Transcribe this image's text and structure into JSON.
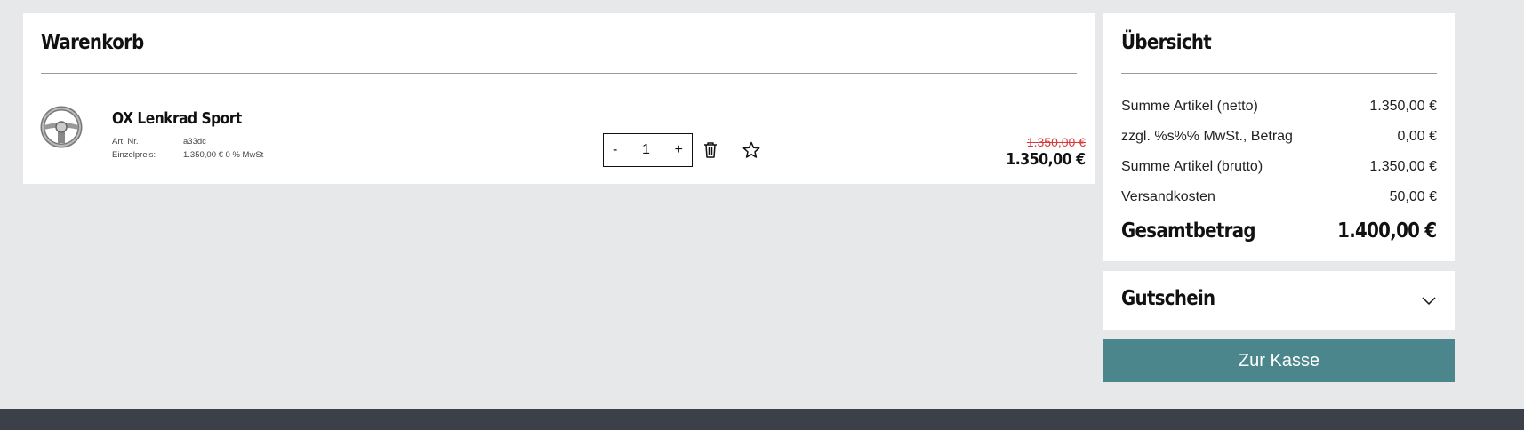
{
  "cart": {
    "title": "Warenkorb",
    "item": {
      "image_alt": "steering-wheel-product-image",
      "name": "OX Lenkrad Sport",
      "art_nr_label": "Art. Nr.",
      "art_nr": "a33dc",
      "unit_price_label": "Einzelpreis:",
      "unit_price": "1.350,00 € 0 % MwSt",
      "quantity": "1",
      "minus_label": "-",
      "plus_label": "+",
      "old_price": "1.350,00 €",
      "price": "1.350,00 €"
    }
  },
  "summary": {
    "title": "Übersicht",
    "rows": [
      {
        "label": "Summe Artikel (netto)",
        "value": "1.350,00 €"
      },
      {
        "label": "zzgl. %s%% MwSt., Betrag",
        "value": "0,00 €"
      },
      {
        "label": "Summe Artikel (brutto)",
        "value": "1.350,00 €"
      },
      {
        "label": "Versandkosten",
        "value": "50,00 €"
      }
    ],
    "total_label": "Gesamtbetrag",
    "total_value": "1.400,00 €"
  },
  "voucher": {
    "title": "Gutschein"
  },
  "checkout": {
    "label": "Zur Kasse"
  },
  "colors": {
    "accent": "#4a868c",
    "strike_price": "#d63b3b",
    "footer": "#3c4049",
    "background": "#e7e8ea"
  },
  "icons": [
    "trash-icon",
    "star-icon",
    "chevron-down-icon"
  ]
}
